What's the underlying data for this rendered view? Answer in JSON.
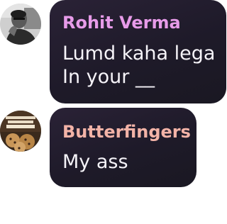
{
  "messages": [
    {
      "sender": "Rohit Verma",
      "lines": [
        "Lumd kaha lega",
        "In your __"
      ],
      "name_color": "#e79be9",
      "avatar": "man-photo-avatar"
    },
    {
      "sender": "Butterfingers",
      "lines": [
        "My ass"
      ],
      "name_color": "#f3b3a7",
      "avatar": "cookies-sticker-avatar"
    }
  ],
  "colors": {
    "bubble_bg": "#1e1a29",
    "message_text": "#f5f3f8",
    "page_bg": "#ffffff"
  }
}
